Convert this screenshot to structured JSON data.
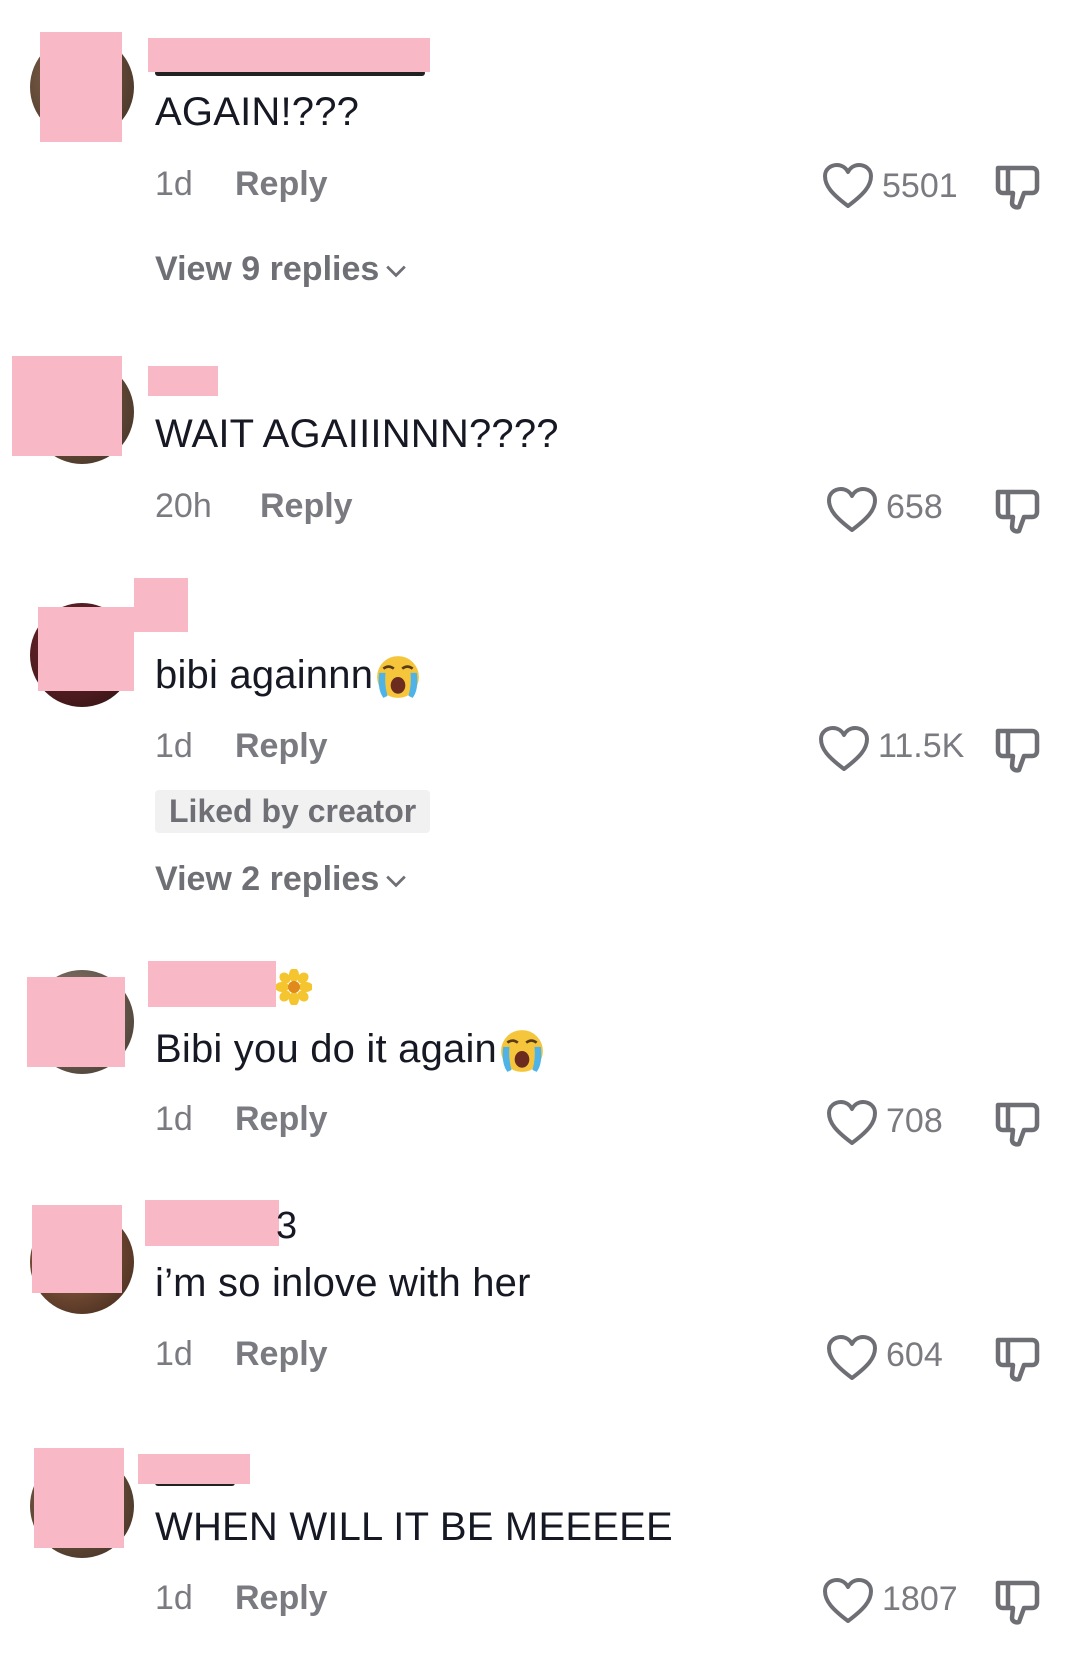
{
  "comments": [
    {
      "text": "AGAIN!???",
      "age": "1d",
      "reply_label": "Reply",
      "likes": "5501",
      "view_replies": "View 9 replies"
    },
    {
      "text": "WAIT AGAIIINNN????",
      "age": "20h",
      "reply_label": "Reply",
      "likes": "658"
    },
    {
      "text": "bibi againnn",
      "age": "1d",
      "reply_label": "Reply",
      "likes": "11.5K",
      "badge": "Liked by creator",
      "view_replies": "View 2 replies"
    },
    {
      "text": "Bibi you do it again",
      "age": "1d",
      "reply_label": "Reply",
      "likes": "708"
    },
    {
      "username_visible_fragment": "3",
      "text": "i’m so inlove with her",
      "age": "1d",
      "reply_label": "Reply",
      "likes": "604"
    },
    {
      "text": "WHEN WILL IT BE MEEEEE",
      "age": "1d",
      "reply_label": "Reply",
      "likes": "1807"
    }
  ],
  "icons": {
    "like": "heart-outline-icon",
    "dislike": "thumbs-down-icon",
    "expand": "chevron-down-icon",
    "crying": "loudly-crying-face-emoji",
    "flower": "blossom-emoji"
  },
  "colors": {
    "text": "#161823",
    "secondary": "#7a7b80",
    "redaction": "#f8b8c6",
    "badge_bg": "#f1f1f2"
  }
}
